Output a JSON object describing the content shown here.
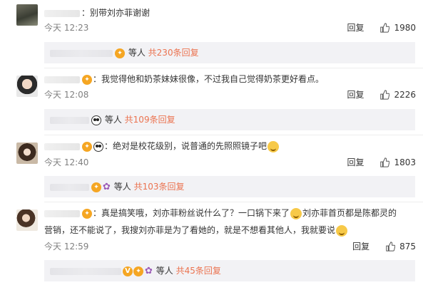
{
  "comments": [
    {
      "text": "：别带刘亦菲谢谢",
      "time": "今天 12:23",
      "reply_label": "回复",
      "likes": "1980",
      "sub": {
        "people": "等人",
        "count_text": "共230条回复"
      }
    },
    {
      "text": "：我觉得他和奶茶妹妹很像，不过我自己觉得奶茶更好看点。",
      "time": "今天 12:08",
      "reply_label": "回复",
      "likes": "2226",
      "sub": {
        "people": "等人",
        "count_text": "共109条回复"
      }
    },
    {
      "text": "：绝对是校花级别，说普通的先照照镜子吧",
      "time": "今天 12:40",
      "reply_label": "回复",
      "likes": "1803",
      "sub": {
        "people": "等人",
        "count_text": "共103条回复"
      }
    },
    {
      "text_a": "：真是搞笑哦，刘亦菲粉丝说什么了？一口锅下来了",
      "text_b": "刘亦菲首页都是陈都灵的",
      "text_c": "营销，还不能说了，我搜刘亦菲是为了看她的，就是不想看其他人，我就要说",
      "time": "今天 12:59",
      "reply_label": "回复",
      "likes": "875",
      "sub": {
        "people": "等人",
        "count_text": "共45条回复"
      }
    }
  ],
  "colors": {
    "accent": "#eb7350",
    "meta": "#808080",
    "sub_bg": "#f2f2f5"
  },
  "icons": {
    "like": "thumb-up-icon",
    "badge": "vip-badge-icon",
    "panda": "panda-icon",
    "flower": "flower-icon",
    "smile": "smile-emoji-icon"
  }
}
